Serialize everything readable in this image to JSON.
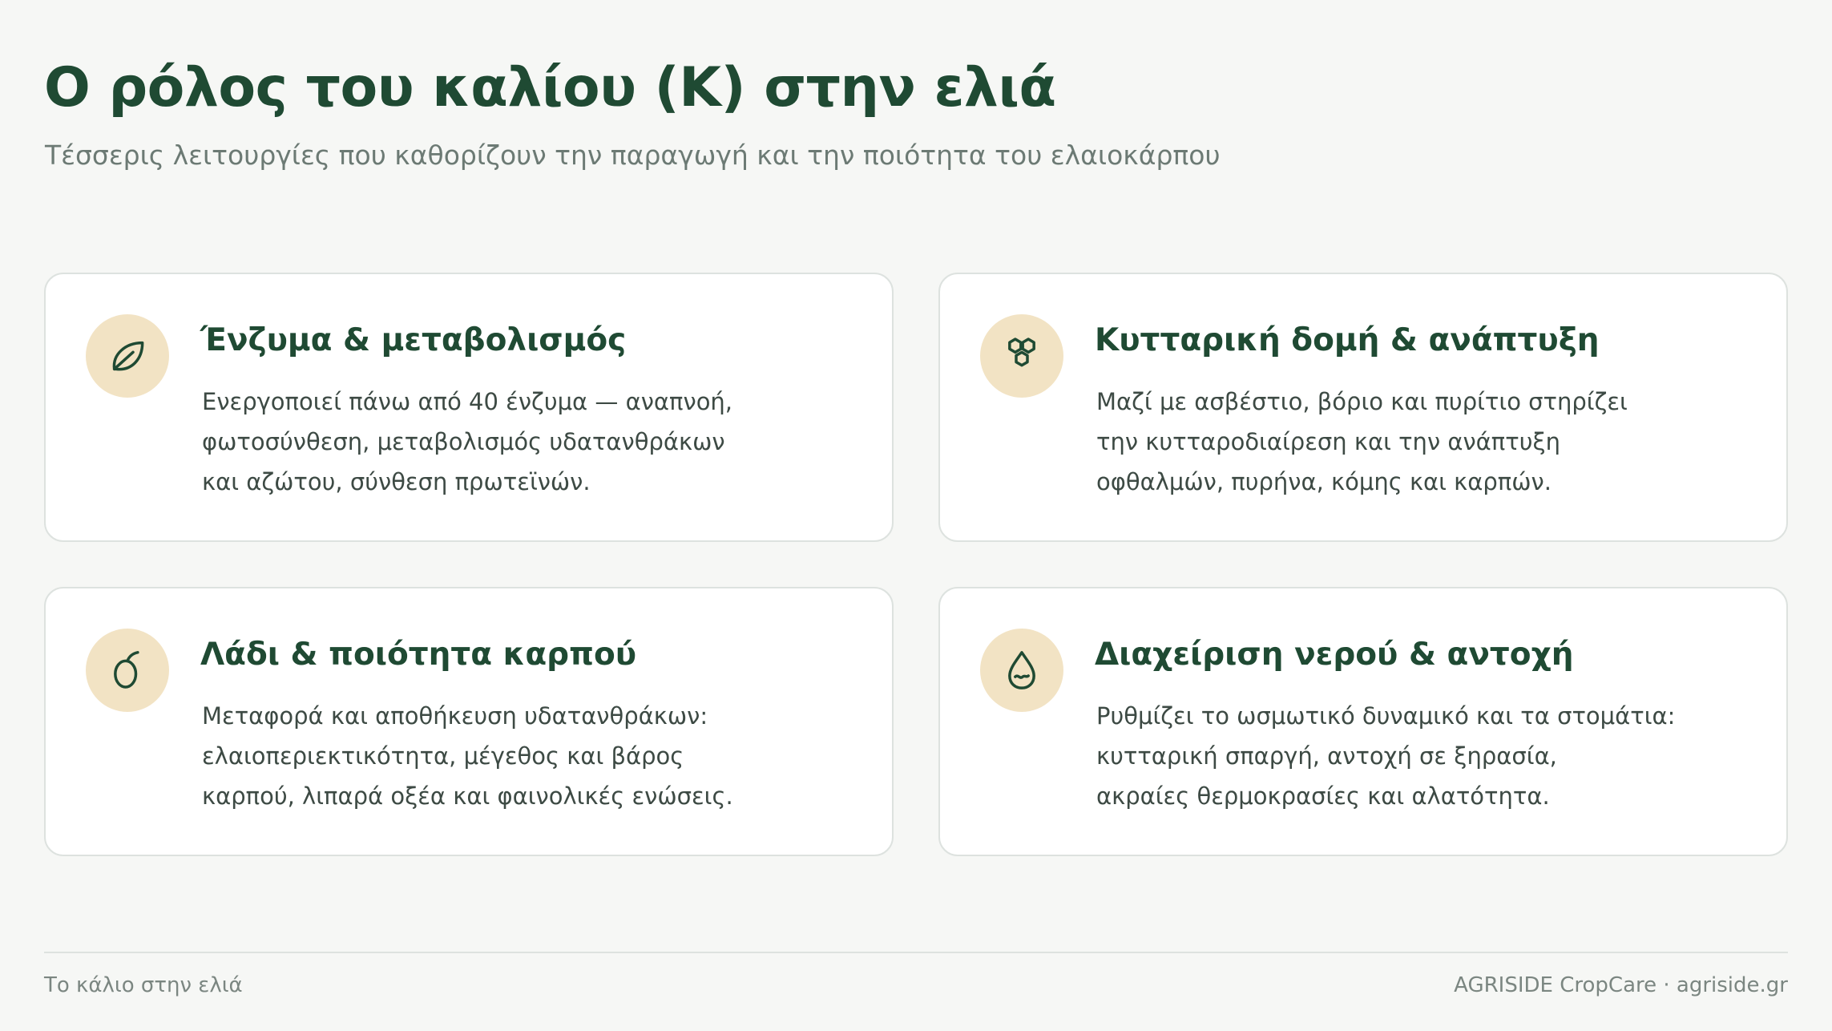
{
  "header": {
    "title": "Ο ρόλος του καλίου (K) στην ελιά",
    "subtitle": "Τέσσερις λειτουργίες που καθορίζουν την παραγωγή και την ποιότητα του ελαιοκάρπου"
  },
  "cards": [
    {
      "icon": "leaf-icon",
      "title": "Ένζυμα & μεταβολισμός",
      "lines": [
        "Ενεργοποιεί πάνω από 40 ένζυμα — αναπνοή,",
        "φωτοσύνθεση, μεταβολισμός υδατανθράκων",
        "και αζώτου, σύνθεση πρωτεϊνών."
      ]
    },
    {
      "icon": "cells-icon",
      "title": "Κυτταρική δομή & ανάπτυξη",
      "lines": [
        "Μαζί με ασβέστιο, βόριο και πυρίτιο στηρίζει",
        "την κυτταροδιαίρεση και την ανάπτυξη",
        "οφθαλμών, πυρήνα, κόμης και καρπών."
      ]
    },
    {
      "icon": "olive-icon",
      "title": "Λάδι & ποιότητα καρπού",
      "lines": [
        "Μεταφορά και αποθήκευση υδατανθράκων:",
        "ελαιοπεριεκτικότητα, μέγεθος και βάρος",
        "καρπού, λιπαρά οξέα και φαινολικές ενώσεις."
      ]
    },
    {
      "icon": "water-drop-icon",
      "title": "Διαχείριση νερού & αντοχή",
      "lines": [
        "Ρυθμίζει το ωσμωτικό δυναμικό και τα στομάτια:",
        "κυτταρική σπαργή, αντοχή σε ξηρασία,",
        "ακραίες θερμοκρασίες και αλατότητα."
      ]
    }
  ],
  "footer": {
    "left": "Το κάλιο στην ελιά",
    "right": "AGRISIDE CropCare · agriside.gr"
  },
  "colors": {
    "background": "#f6f7f5",
    "title": "#1f4a33",
    "icon_bg": "#f2e3c4",
    "card_border": "#dde2df"
  }
}
